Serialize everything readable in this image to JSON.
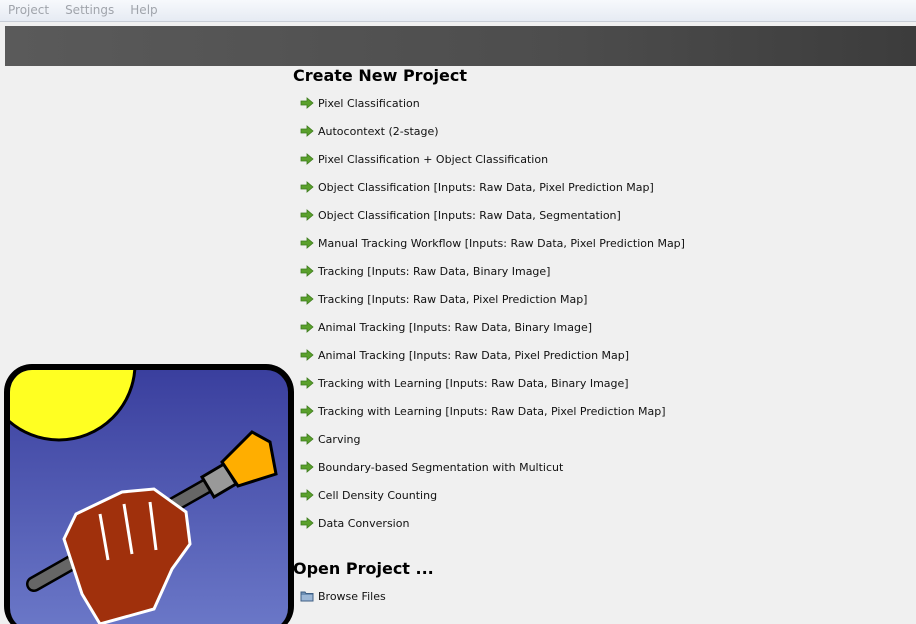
{
  "menu": [
    "Project",
    "Settings",
    "Help"
  ],
  "create_title": "Create New Project",
  "workflows": [
    "Pixel Classification",
    "Autocontext (2-stage)",
    "Pixel Classification + Object Classification",
    "Object Classification [Inputs: Raw Data, Pixel Prediction Map]",
    "Object Classification [Inputs: Raw Data, Segmentation]",
    "Manual Tracking Workflow [Inputs: Raw Data, Pixel Prediction Map]",
    "Tracking [Inputs: Raw Data, Binary Image]",
    "Tracking [Inputs: Raw Data, Pixel Prediction Map]",
    "Animal Tracking [Inputs: Raw Data, Binary Image]",
    "Animal Tracking [Inputs: Raw Data, Pixel Prediction Map]",
    "Tracking with Learning [Inputs: Raw Data, Binary Image]",
    "Tracking with Learning [Inputs: Raw Data, Pixel Prediction Map]",
    "Carving",
    "Boundary-based Segmentation with Multicut",
    "Cell Density Counting",
    "Data Conversion"
  ],
  "open_title": "Open Project ...",
  "browse_label": "Browse Files",
  "icons": {
    "workflow": "green-arrow-icon",
    "browse": "folder-icon"
  },
  "colors": {
    "arrow": "#5aa02c",
    "banner": "#4d4d4d",
    "logo_bg": "#4a4fae",
    "sun": "#ffff22",
    "fist": "#a0300c",
    "brush": "#ffae00"
  }
}
